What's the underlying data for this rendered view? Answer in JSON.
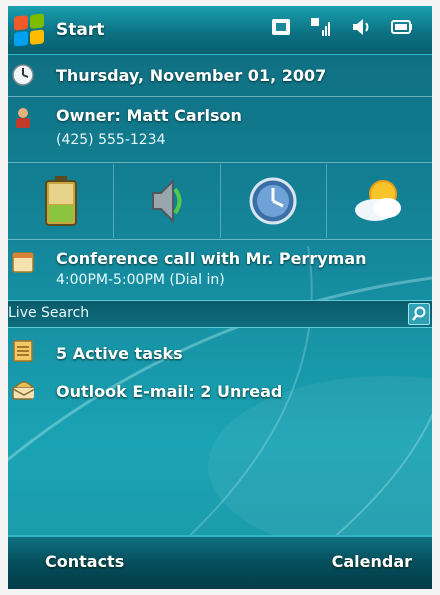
{
  "titlebar": {
    "start_label": "Start",
    "status_icons": [
      "data-connection-icon",
      "signal-strength-icon",
      "volume-icon",
      "battery-icon"
    ]
  },
  "today": {
    "date": "Thursday, November 01, 2007",
    "owner_name": "Owner: Matt Carlson",
    "owner_phone": "(425) 555-1234",
    "shortcuts": [
      "battery-shortcut",
      "speaker-shortcut",
      "clock-shortcut",
      "weather-shortcut"
    ],
    "appointment_title": "Conference call with Mr. Perryman",
    "appointment_time": "4:00PM-5:00PM (Dial in)",
    "search_label": "Live Search",
    "tasks": "5 Active tasks",
    "email": "Outlook E-mail: 2 Unread"
  },
  "softkeys": {
    "left": "Contacts",
    "right": "Calendar"
  },
  "colors": {
    "accent": "#14869a",
    "title_bar": "#0c7283",
    "text": "#ffffff"
  }
}
